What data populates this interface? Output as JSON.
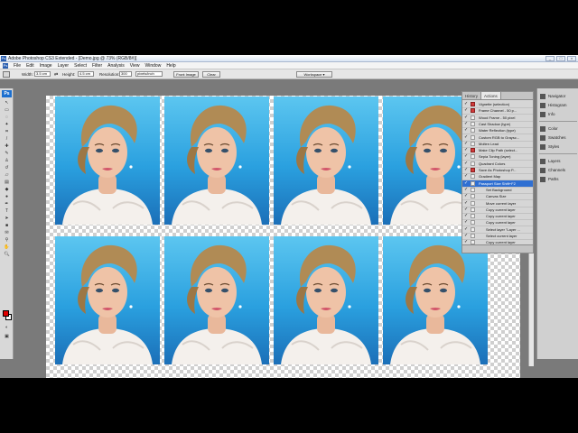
{
  "window": {
    "app_icon": "Ps",
    "title": "Adobe Photoshop CS3 Extended - [Demo.jpg @ 73% (RGB/8#)]",
    "controls": [
      "_",
      "□",
      "×"
    ]
  },
  "menu": {
    "app_icon": "Ps",
    "items": [
      "File",
      "Edit",
      "Image",
      "Layer",
      "Select",
      "Filter",
      "Analysis",
      "View",
      "Window",
      "Help"
    ]
  },
  "options": {
    "width_label": "Width:",
    "width_value": "3.5 cm",
    "height_label": "Height:",
    "height_value": "4.5 cm",
    "resolution_label": "Resolution:",
    "resolution_value": "300",
    "resolution_unit": "pixels/inch",
    "front_image_label": "Front Image",
    "clear_label": "Clear",
    "workspace_label": "Workspace ▾"
  },
  "toolbox": {
    "logo": "Ps"
  },
  "panel": {
    "tabs": [
      "History",
      "Actions"
    ],
    "actions": [
      {
        "label": "Vignette (selection)",
        "dialog": "red"
      },
      {
        "label": "Frame Channel - 50 p...",
        "dialog": "red"
      },
      {
        "label": "Wood Frame - 50 pixel",
        "dialog": "none"
      },
      {
        "label": "Cast Shadow (type)",
        "dialog": "none"
      },
      {
        "label": "Water Reflection (type)",
        "dialog": "none"
      },
      {
        "label": "Custom RGB to Graysc...",
        "dialog": "none"
      },
      {
        "label": "Molten Lead",
        "dialog": "none"
      },
      {
        "label": "Make Clip Path (select...",
        "dialog": "red"
      },
      {
        "label": "Sepia Toning (layer)",
        "dialog": "none"
      },
      {
        "label": "Quadrant Colors",
        "dialog": "none"
      },
      {
        "label": "Save As Photoshop P...",
        "dialog": "red"
      },
      {
        "label": "Gradient Map",
        "dialog": "none"
      },
      {
        "label": "Passport Size  Shift+F2",
        "dialog": "none",
        "selected": true
      },
      {
        "label": "Set Background",
        "dialog": "none",
        "sub": true
      },
      {
        "label": "Canvas Size",
        "dialog": "none",
        "sub": true
      },
      {
        "label": "Move current layer",
        "dialog": "none",
        "sub": true
      },
      {
        "label": "Copy current layer",
        "dialog": "none",
        "sub": true
      },
      {
        "label": "Copy current layer",
        "dialog": "none",
        "sub": true
      },
      {
        "label": "Copy current layer",
        "dialog": "none",
        "sub": true
      },
      {
        "label": "Select layer \"Layer ...",
        "dialog": "none",
        "sub": true
      },
      {
        "label": "Select current layer",
        "dialog": "none",
        "sub": true
      },
      {
        "label": "Copy current layer",
        "dialog": "none",
        "sub": true
      }
    ]
  },
  "dock": {
    "items": [
      "Navigator",
      "Histogram",
      "Info",
      "Color",
      "Swatches",
      "Styles",
      "Layers",
      "Channels",
      "Paths"
    ]
  },
  "colors": {
    "foreground": "#e00000",
    "background": "#ffffff",
    "accent": "#2f6fd2"
  }
}
